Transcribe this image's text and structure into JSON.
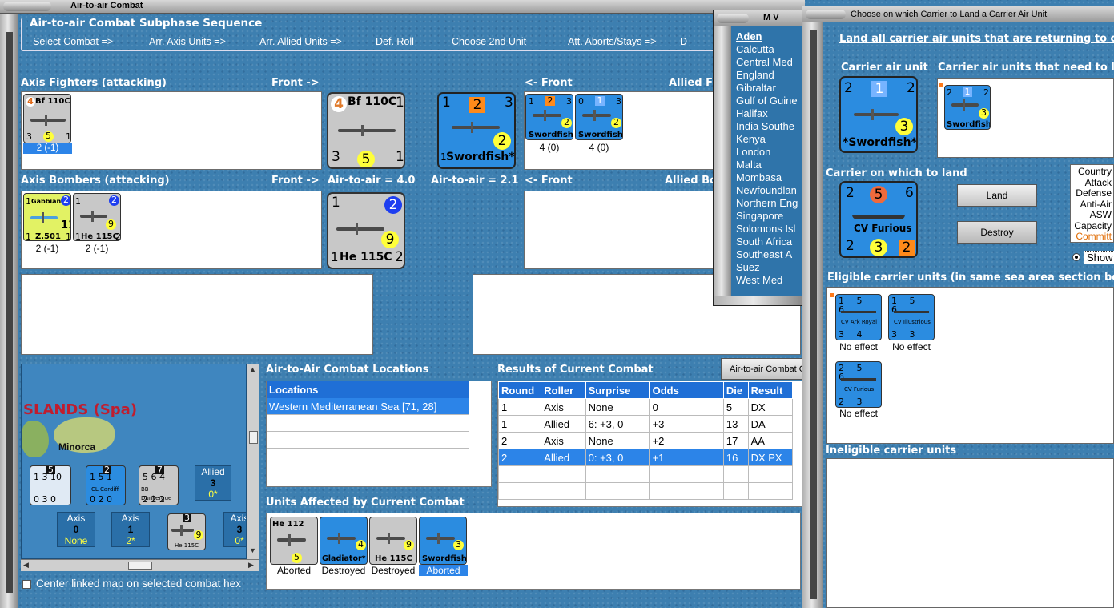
{
  "window": {
    "title": "Air-to-air Combat"
  },
  "sequence": {
    "title": "Air-to-air Combat Subphase Sequence",
    "steps": [
      "Select Combat =>",
      "Arr. Axis Units =>",
      "Arr. Allied Units =>",
      "Def. Roll",
      "Choose 2nd Unit",
      "Att. Aborts/Stays =>",
      "D"
    ]
  },
  "fighters": {
    "axis_label": "Axis Fighters (attacking)",
    "front_right": "Front ->",
    "front_left": "<- Front",
    "allied_label": "Allied Fi",
    "axis_units": [
      {
        "name": "Bf 110C",
        "tl": "4",
        "tr": "1",
        "bl": "3",
        "bc": "5",
        "br": "1",
        "caption": "2 (-1)"
      }
    ],
    "allied_units": [
      {
        "name": "Swordfish",
        "tl": "1",
        "tc": "2",
        "tr": "3",
        "bc": "2",
        "caption": "4 (0)"
      },
      {
        "name": "Swordfish",
        "tl": "0",
        "tc": "1",
        "tr": "3",
        "bc": "2",
        "caption": "4 (0)"
      }
    ]
  },
  "big_axis_fighter": {
    "name": "Bf 110C",
    "tl": "4",
    "tr": "1",
    "bl": "3",
    "bc": "5",
    "br": "1",
    "air_to_air": "Air-to-air = 4.0"
  },
  "big_allied_fighter": {
    "name": "Swordfish*",
    "tl": "1",
    "tc": "2",
    "tr": "3",
    "bl": "1",
    "bc": "2",
    "air_to_air": "Air-to-air = 2.1"
  },
  "bombers": {
    "axis_label": "Axis Bombers (attacking)",
    "front_right": "Front ->",
    "front_left": "<- Front",
    "allied_label": "Allied Bo",
    "axis_units": [
      {
        "name": "Z.501",
        "top": "Gabbiano",
        "tl": "1",
        "tr": "2",
        "bc": "11",
        "bl": "1",
        "br": "1",
        "caption": "2 (-1)"
      },
      {
        "name": "He 115C",
        "tl": "1",
        "tr": "2",
        "bc": "9",
        "bl": "1",
        "br": "2",
        "caption": "2 (-1)"
      }
    ]
  },
  "big_axis_bomber": {
    "name": "He 115C",
    "tl": "1",
    "tr": "2",
    "bc": "9",
    "bl": "1",
    "br": "2"
  },
  "map": {
    "label": "SLANDS (Spa)",
    "island": "Minorca",
    "center_checkbox": "Center linked map on selected combat hex",
    "stacks": [
      {
        "badge": "5",
        "top": "1 3 10",
        "bottom": "0 3 0"
      },
      {
        "badge": "2",
        "name": "CL Cardiff",
        "top": "1 5 1",
        "bottom": "0 2 0"
      },
      {
        "badge": "7",
        "name": "BB Dunkerque",
        "top": "5 6 4",
        "bottom": "2 2 2"
      }
    ],
    "boxes": [
      {
        "title": "Allied",
        "value": "3",
        "sub": "0*"
      },
      {
        "title": "Axis",
        "value": "0",
        "sub": "None"
      },
      {
        "title": "Axis",
        "value": "1",
        "sub": "2*"
      },
      {
        "title": "Axis",
        "value": "3",
        "sub": "0*"
      }
    ],
    "map_unit": {
      "badge": "3",
      "name": "He 115C",
      "num": "9"
    }
  },
  "locations": {
    "title": "Air-to-Air Combat Locations",
    "header": "Locations",
    "items": [
      "Western Mediterranean Sea [71, 28]"
    ]
  },
  "results": {
    "title": "Results of Current Combat",
    "button": "Air-to-air Combat Cl",
    "columns": [
      "Round",
      "Roller",
      "Surprise",
      "Odds",
      "Die",
      "Result"
    ],
    "rows": [
      [
        "1",
        "Axis",
        "None",
        "0",
        "5",
        "DX"
      ],
      [
        "1",
        "Allied",
        "6: +3, 0",
        "+3",
        "13",
        "DA"
      ],
      [
        "2",
        "Axis",
        "None",
        "+2",
        "17",
        "AA"
      ],
      [
        "2",
        "Allied",
        "0: +3, 0",
        "+1",
        "16",
        "DX PX"
      ]
    ]
  },
  "affected": {
    "title": "Units Affected by Current Combat",
    "units": [
      {
        "name": "He 112",
        "num": "5",
        "caption": "Aborted"
      },
      {
        "name": "Gladiator*",
        "num": "4",
        "caption": "Destroyed"
      },
      {
        "name": "He 115C",
        "num": "9",
        "caption": "Destroyed"
      },
      {
        "name": "Swordfish",
        "num": "3",
        "caption": "Aborted"
      }
    ]
  },
  "mv": {
    "title": "M V",
    "items": [
      "Aden",
      "Calcutta",
      "Central Med",
      "England",
      "Gibraltar",
      "Gulf of Guine",
      "Halifax",
      "India Southe",
      "Kenya",
      "London",
      "Malta",
      "Mombasa",
      "Newfoundlan",
      "Northern Eng",
      "Singapore",
      "Solomons Isl",
      "South Africa",
      "Southeast A",
      "Suez",
      "West Med"
    ]
  },
  "carrier": {
    "title": "Choose on which Carrier to Land a Carrier Air Unit",
    "instruction": "Land all carrier air units that are returning to ca",
    "air_unit_label": "Carrier air unit",
    "need_label": "Carrier air units that need to la",
    "air_unit": {
      "name": "*Swordfish*",
      "tl": "2",
      "tc": "1",
      "tr": "2",
      "bc": "3"
    },
    "need_unit": {
      "name": "Swordfish",
      "tl": "2",
      "tc": "1",
      "tr": "2",
      "bc": "3"
    },
    "land_on_label": "Carrier on which to land",
    "carrier_unit": {
      "name": "CV Furious",
      "tl": "2",
      "tc": "5",
      "tr": "6",
      "bl": "2",
      "bc": "3",
      "br": "2"
    },
    "land_button": "Land",
    "destroy_button": "Destroy",
    "stats": [
      "Country",
      "Attack",
      "Defense",
      "Anti-Air",
      "ASW",
      "Capacity",
      "Committ"
    ],
    "show_label": "Show",
    "eligible_label": "Eligible carrier units (in same sea area section bo",
    "eligible": [
      {
        "name": "CV Ark Royal",
        "top": "1 5 6",
        "bottom": "3 4 3",
        "caption": "No effect"
      },
      {
        "name": "CV Illustrious",
        "top": "1 5 6",
        "bottom": "3 3 2",
        "caption": "No effect"
      },
      {
        "name": "CV Furious",
        "top": "2 5 6",
        "bottom": "2 3 2",
        "caption": "No effect"
      }
    ],
    "ineligible_label": "Ineligible carrier units"
  },
  "colors": {
    "accent": "#1f6fd6",
    "selected": "#2c84e8",
    "panel": "#3d7fb0"
  }
}
